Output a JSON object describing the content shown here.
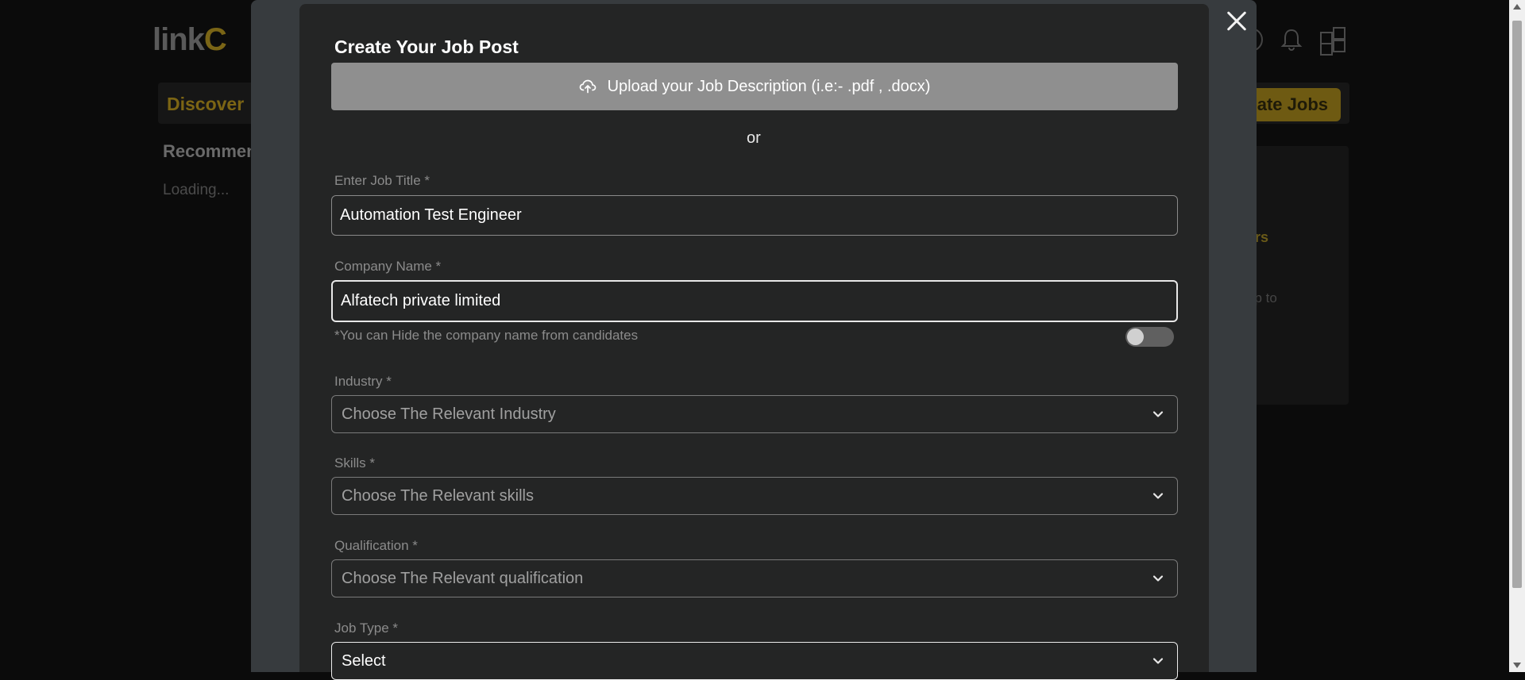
{
  "background": {
    "logo_main": "link",
    "logo_accent": "C",
    "nav_discover": "Discover",
    "create_jobs": "ate Jobs",
    "recommended": "Recommen",
    "loading": "Loading...",
    "panel_text_a": "ers",
    "panel_text_b": "up to"
  },
  "modal": {
    "title": "Create Your Job Post",
    "upload_label": "Upload your Job Description (i.e:- .pdf , .docx)",
    "or_text": "or",
    "job_title": {
      "label": "Enter Job Title *",
      "value": "Automation Test Engineer"
    },
    "company_name": {
      "label": "Company Name *",
      "value": "Alfatech private limited",
      "hint": "*You can Hide the company name from candidates",
      "hide_toggle_on": false
    },
    "industry": {
      "label": "Industry *",
      "placeholder": "Choose The Relevant Industry"
    },
    "skills": {
      "label": "Skills *",
      "placeholder": "Choose The Relevant skills"
    },
    "qualification": {
      "label": "Qualification *",
      "placeholder": "Choose The Relevant qualification"
    },
    "job_type": {
      "label": "Job Type *",
      "value": "Select"
    }
  },
  "icons": {
    "close": "close-icon",
    "upload": "cloud-upload-icon",
    "chevron": "chevron-down-icon"
  },
  "colors": {
    "accent": "#7c6514",
    "modal_bg": "#242525",
    "overlay_bg": "#373b3e",
    "upload_button": "#8f8f8f"
  }
}
